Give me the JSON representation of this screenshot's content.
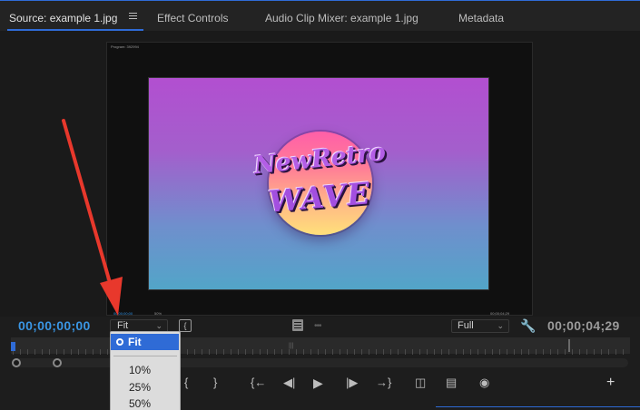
{
  "tabs": {
    "source": "Source: example 1.jpg",
    "effect_controls": "Effect Controls",
    "audio_clip_mixer": "Audio Clip Mixer: example 1.jpg",
    "metadata": "Metadata"
  },
  "embedded_monitor": {
    "title": "Program: 392994",
    "timecode_left": "00;00;00;00",
    "zoom": "50%",
    "timecode_right": "00;00;04;29"
  },
  "image": {
    "logo_line_1": "NewRetro",
    "logo_line_2": "WAVE"
  },
  "controls": {
    "timecode_current": "00;00;00;00",
    "timecode_duration": "00;00;04;29",
    "zoom_select": "Fit",
    "resolution_select": "Full"
  },
  "dropdown": {
    "selected": "Fit",
    "items": [
      "10%",
      "25%",
      "50%"
    ]
  },
  "transport": {
    "mark_in": "{",
    "mark_out": "}",
    "go_to_in": "{←",
    "step_back": "◀|",
    "play": "▶",
    "step_forward": "|▶",
    "go_to_out": "→}",
    "add": "+"
  },
  "colors": {
    "accent_blue": "#2f6bd6",
    "timecode_blue": "#3a95e3",
    "annotation_red": "#e8382c"
  }
}
